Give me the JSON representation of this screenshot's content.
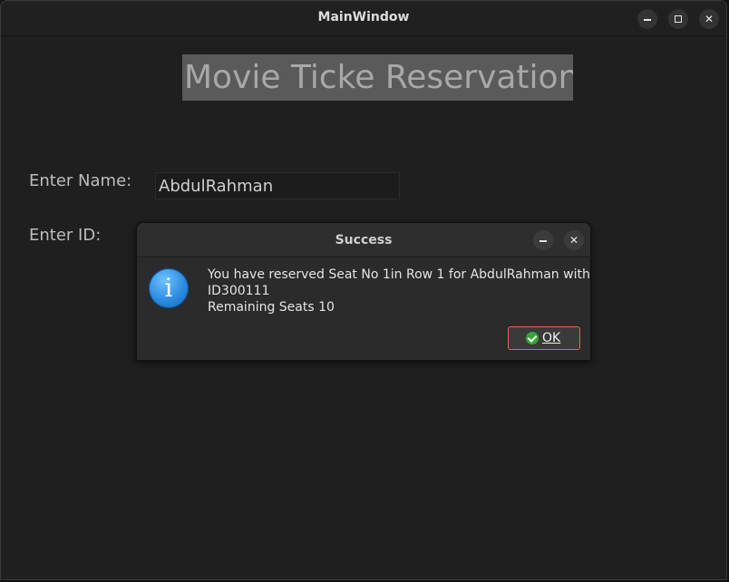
{
  "window": {
    "title": "MainWindow",
    "minimize_label": "–",
    "close_label": "✕"
  },
  "form": {
    "heading": "Movie Ticke Reservation",
    "name_label": "Enter Name:",
    "name_value": "AbdulRahman",
    "id_label": "Enter ID:"
  },
  "dialog": {
    "title": "Success",
    "close_label": "✕",
    "icon": "information-icon",
    "icon_glyph": "i",
    "message_line1": "You have reserved Seat No 1in Row 1 for AbdulRahman with",
    "message_line2": "ID300111",
    "message_line3": "Remaining Seats 10",
    "ok_label": "OK"
  },
  "colors": {
    "accent_border": "#d86c4a",
    "info_icon": "#2b8be0",
    "check_icon": "#35a535"
  }
}
